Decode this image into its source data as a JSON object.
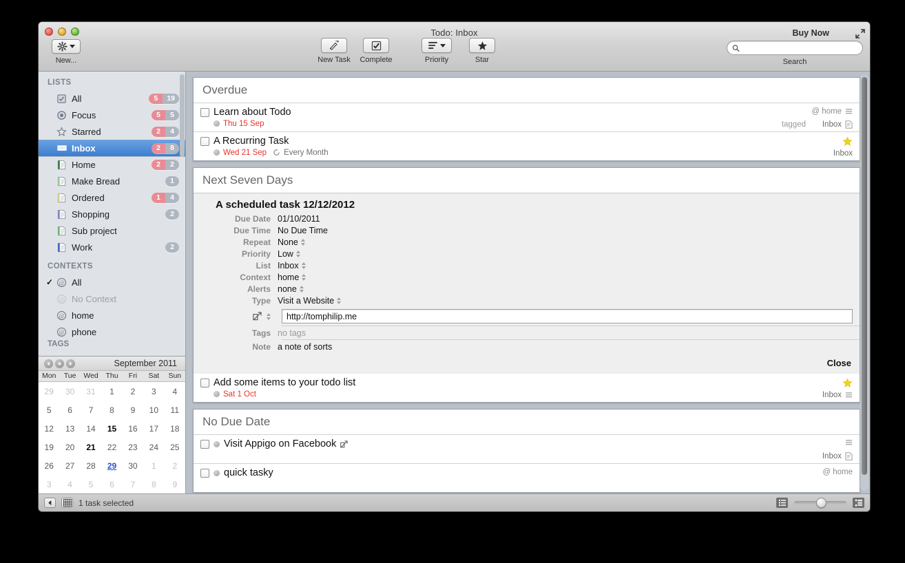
{
  "window": {
    "title": "Todo: Inbox",
    "buy_now": "Buy Now"
  },
  "toolbar": {
    "new_label": "New...",
    "new_task": "New Task",
    "complete": "Complete",
    "priority": "Priority",
    "star": "Star",
    "search_label": "Search",
    "search_value": "",
    "search_placeholder": ""
  },
  "sidebar": {
    "lists_header": "LISTS",
    "contexts_header": "CONTEXTS",
    "tags_header": "TAGS",
    "lists": [
      {
        "label": "All",
        "icon": "checkbox-icon",
        "red": "5",
        "gray": "19",
        "selected": false
      },
      {
        "label": "Focus",
        "icon": "focus-icon",
        "red": "5",
        "gray": "5",
        "selected": false
      },
      {
        "label": "Starred",
        "icon": "star-icon",
        "red": "2",
        "gray": "4",
        "selected": false
      },
      {
        "label": "Inbox",
        "icon": "inbox-icon",
        "red": "2",
        "gray": "8",
        "selected": true
      },
      {
        "label": "Home",
        "icon": "list-icon",
        "red": "2",
        "gray": "2",
        "selected": false,
        "color": "#2f7b37"
      },
      {
        "label": "Make Bread",
        "icon": "list-icon",
        "red": "",
        "gray": "1",
        "selected": false,
        "color": "#9fd39a"
      },
      {
        "label": "Ordered",
        "icon": "list-icon",
        "red": "1",
        "gray": "4",
        "selected": false,
        "color": "#e4dc7a"
      },
      {
        "label": "Shopping",
        "icon": "list-icon",
        "red": "",
        "gray": "2",
        "selected": false,
        "color": "#8f7ec9"
      },
      {
        "label": "Sub project",
        "icon": "list-icon",
        "red": "",
        "gray": "",
        "selected": false,
        "color": "#6fc070"
      },
      {
        "label": "Work",
        "icon": "list-icon",
        "red": "",
        "gray": "2",
        "selected": false,
        "color": "#3a63c0"
      }
    ],
    "contexts": [
      {
        "label": "All",
        "checked": true,
        "muted": false
      },
      {
        "label": "No Context",
        "checked": false,
        "muted": true
      },
      {
        "label": "home",
        "checked": false,
        "muted": false
      },
      {
        "label": "phone",
        "checked": false,
        "muted": false
      }
    ]
  },
  "calendar": {
    "title": "September 2011",
    "dows": [
      "Mon",
      "Tue",
      "Wed",
      "Thu",
      "Fri",
      "Sat",
      "Sun"
    ],
    "weeks": [
      [
        {
          "d": "29",
          "s": "out"
        },
        {
          "d": "30",
          "s": "out"
        },
        {
          "d": "31",
          "s": "out"
        },
        {
          "d": "1",
          "s": ""
        },
        {
          "d": "2",
          "s": ""
        },
        {
          "d": "3",
          "s": ""
        },
        {
          "d": "4",
          "s": ""
        }
      ],
      [
        {
          "d": "5",
          "s": ""
        },
        {
          "d": "6",
          "s": ""
        },
        {
          "d": "7",
          "s": ""
        },
        {
          "d": "8",
          "s": ""
        },
        {
          "d": "9",
          "s": ""
        },
        {
          "d": "10",
          "s": ""
        },
        {
          "d": "11",
          "s": ""
        }
      ],
      [
        {
          "d": "12",
          "s": ""
        },
        {
          "d": "13",
          "s": ""
        },
        {
          "d": "14",
          "s": ""
        },
        {
          "d": "15",
          "s": "hasTask"
        },
        {
          "d": "16",
          "s": ""
        },
        {
          "d": "17",
          "s": ""
        },
        {
          "d": "18",
          "s": ""
        }
      ],
      [
        {
          "d": "19",
          "s": ""
        },
        {
          "d": "20",
          "s": ""
        },
        {
          "d": "21",
          "s": "hasTask"
        },
        {
          "d": "22",
          "s": ""
        },
        {
          "d": "23",
          "s": ""
        },
        {
          "d": "24",
          "s": ""
        },
        {
          "d": "25",
          "s": ""
        }
      ],
      [
        {
          "d": "26",
          "s": ""
        },
        {
          "d": "27",
          "s": ""
        },
        {
          "d": "28",
          "s": ""
        },
        {
          "d": "29",
          "s": "today"
        },
        {
          "d": "30",
          "s": ""
        },
        {
          "d": "1",
          "s": "out"
        },
        {
          "d": "2",
          "s": "out"
        }
      ],
      [
        {
          "d": "3",
          "s": "out"
        },
        {
          "d": "4",
          "s": "out"
        },
        {
          "d": "5",
          "s": "out"
        },
        {
          "d": "6",
          "s": "out"
        },
        {
          "d": "7",
          "s": "out"
        },
        {
          "d": "8",
          "s": "out"
        },
        {
          "d": "9",
          "s": "out"
        }
      ]
    ]
  },
  "sections": {
    "overdue": {
      "title": "Overdue",
      "tasks": [
        {
          "title": "Learn about Todo",
          "due": "Thu 15 Sep",
          "repeat": "",
          "context": "@ home",
          "list": "Inbox",
          "tagged": "tagged",
          "starred": false,
          "has_note_icon": true,
          "has_tag_icon": true
        },
        {
          "title": "A Recurring Task",
          "due": "Wed 21 Sep",
          "repeat": "Every Month",
          "context": "",
          "list": "Inbox",
          "tagged": "",
          "starred": true,
          "has_note_icon": false,
          "has_tag_icon": false
        }
      ]
    },
    "next_seven_days": {
      "title": "Next Seven Days",
      "detail": {
        "task_title": "A scheduled task 12/12/2012",
        "fields": [
          {
            "label": "Due Date",
            "value": "01/10/2011",
            "stepper": false,
            "muted": false
          },
          {
            "label": "Due Time",
            "value": "No Due Time",
            "stepper": false,
            "muted": false
          },
          {
            "label": "Repeat",
            "value": "None",
            "stepper": true,
            "muted": false
          },
          {
            "label": "Priority",
            "value": "Low",
            "stepper": true,
            "muted": false
          },
          {
            "label": "List",
            "value": "Inbox",
            "stepper": true,
            "muted": false
          },
          {
            "label": "Context",
            "value": "home",
            "stepper": true,
            "muted": false
          },
          {
            "label": "Alerts",
            "value": "none",
            "stepper": true,
            "muted": false
          },
          {
            "label": "Type",
            "value": "Visit a Website",
            "stepper": true,
            "muted": false
          }
        ],
        "url_value": "http://tomphilip.me",
        "tags_label": "Tags",
        "tags_value": "no tags",
        "note_label": "Note",
        "note_value": "a note of sorts",
        "close_label": "Close"
      },
      "tasks": [
        {
          "title": "Add some items to your todo list",
          "due": "Sat 1 Oct",
          "repeat": "",
          "context": "",
          "list": "Inbox",
          "tagged": "",
          "starred": true,
          "has_note_icon": false,
          "has_tag_icon": true
        }
      ]
    },
    "no_due_date": {
      "title": "No Due Date",
      "tasks": [
        {
          "title": "Visit Appigo on Facebook",
          "due": "",
          "repeat": "",
          "context": "",
          "list": "Inbox",
          "tagged": "",
          "starred": false,
          "link_icon": true,
          "has_note_icon": true,
          "has_tag_icon": true,
          "lead_dot": true
        },
        {
          "title": "quick tasky",
          "due": "",
          "repeat": "",
          "context": "@ home",
          "list": "",
          "tagged": "",
          "starred": false,
          "link_icon": false,
          "has_note_icon": false,
          "has_tag_icon": false,
          "lead_dot": true
        }
      ]
    }
  },
  "statusbar": {
    "status_text": "1 task selected"
  },
  "colors": {
    "selection_blue": "#3b7dd0",
    "overdue_red": "#e8332a",
    "star_yellow": "#f2d411",
    "badge_red": "#e98b94",
    "badge_gray": "#aeb6c0"
  }
}
